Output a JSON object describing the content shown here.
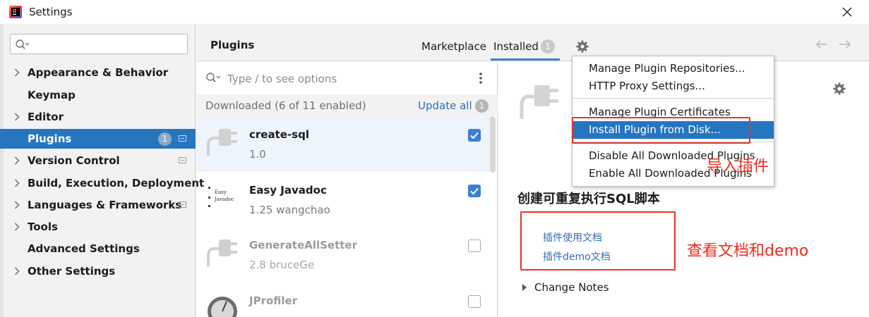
{
  "window": {
    "title": "Settings"
  },
  "sidebar": {
    "search_placeholder": "",
    "items": [
      {
        "label": "Appearance & Behavior",
        "expandable": true
      },
      {
        "label": "Keymap",
        "expandable": false
      },
      {
        "label": "Editor",
        "expandable": true
      },
      {
        "label": "Plugins",
        "expandable": false,
        "selected": true,
        "badge": "1"
      },
      {
        "label": "Version Control",
        "expandable": true
      },
      {
        "label": "Build, Execution, Deployment",
        "expandable": true
      },
      {
        "label": "Languages & Frameworks",
        "expandable": true
      },
      {
        "label": "Tools",
        "expandable": true
      },
      {
        "label": "Advanced Settings",
        "expandable": false
      },
      {
        "label": "Other Settings",
        "expandable": true
      }
    ]
  },
  "header": {
    "title": "Plugins",
    "tabs": [
      {
        "label": "Marketplace",
        "active": false
      },
      {
        "label": "Installed",
        "active": true,
        "badge": "1"
      }
    ]
  },
  "plugin_list": {
    "search_placeholder": "Type / to see options",
    "section_label": "Downloaded (6 of 11 enabled)",
    "update_all_label": "Update all",
    "update_badge": "1",
    "plugins": [
      {
        "name": "create-sql",
        "meta": "1.0",
        "enabled": true,
        "selected": true
      },
      {
        "name": "Easy Javadoc",
        "meta": "1.25  wangchao",
        "enabled": true,
        "icon_text": "Easy Javadoc"
      },
      {
        "name": "GenerateAllSetter",
        "meta": "2.8  bruceGe",
        "enabled": false
      },
      {
        "name": "JProfiler",
        "meta": "",
        "enabled": false
      }
    ]
  },
  "details": {
    "title": "创建可重复执行SQL脚本",
    "links": [
      "插件使用文档",
      "插件demo文档"
    ],
    "change_notes_label": "Change Notes",
    "annotation": "查看文档和demo"
  },
  "gear_menu": {
    "groups": [
      [
        "Manage Plugin Repositories...",
        "HTTP Proxy Settings..."
      ],
      [
        "Manage Plugin Certificates",
        "Install Plugin from Disk..."
      ],
      [
        "Disable All Downloaded Plugins",
        "Enable All Downloaded Plugins"
      ]
    ],
    "active_item": "Install Plugin from Disk...",
    "annotation": "导入插件"
  },
  "colors": {
    "accent": "#2675bf",
    "link": "#2f6fb8",
    "annotation_red": "#e8322b",
    "checkbox_on": "#3b7fd2"
  }
}
